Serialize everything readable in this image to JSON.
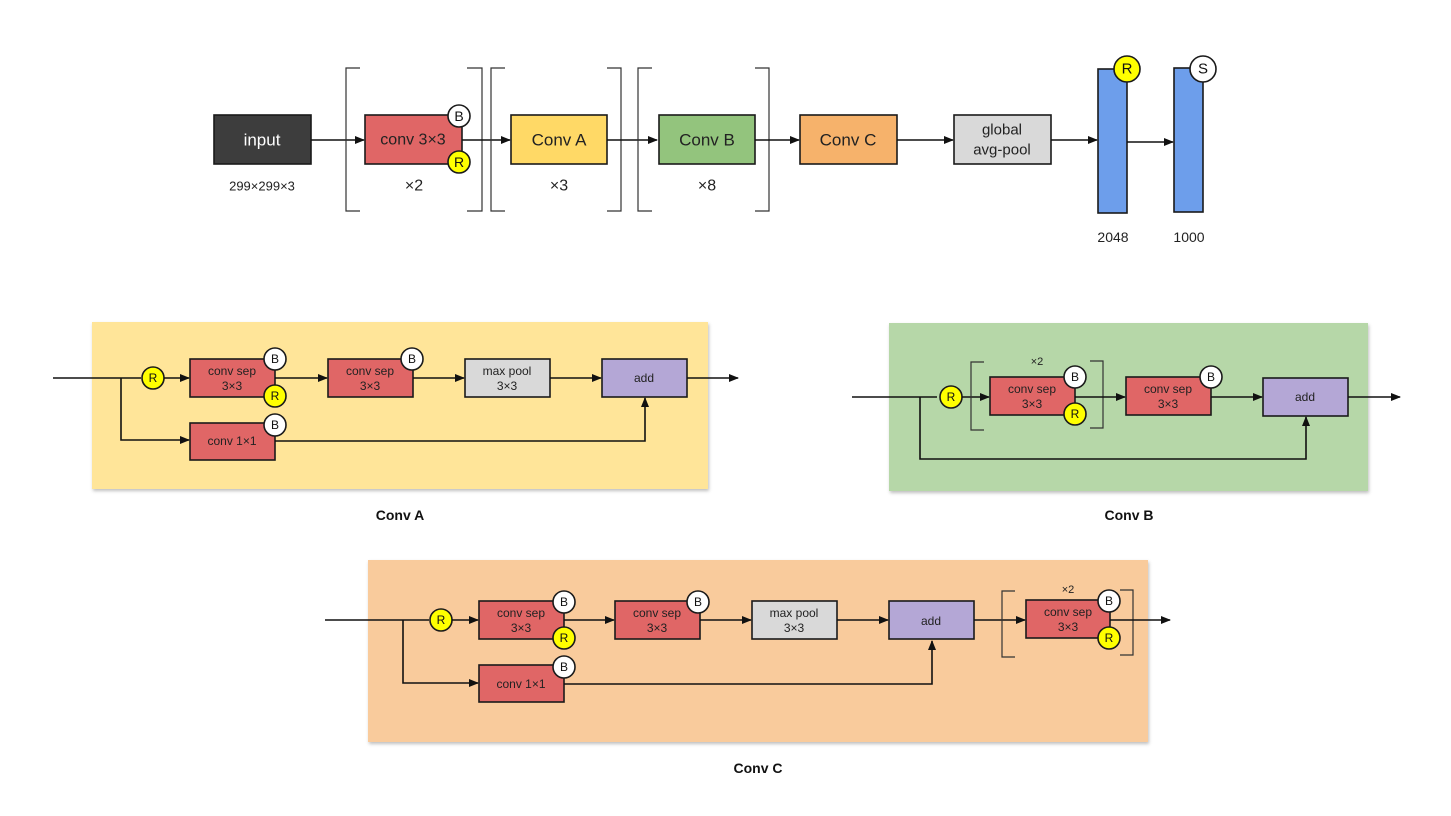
{
  "colors": {
    "input": "#3d3d3d",
    "conv": "#e06666",
    "conv_a": "#ffd966",
    "conv_b": "#93c47d",
    "conv_c": "#f6b26b",
    "pool": "#d9d9d9",
    "add": "#b4a7d6",
    "dense": "#6d9eeb",
    "badge_r": "#ffff00",
    "badge_b": "#ffffff",
    "panel_a": "#ffe599",
    "panel_b": "#b6d7a8",
    "panel_c": "#f9cb9c"
  },
  "badges": {
    "relu": "R",
    "batchnorm": "B",
    "softmax": "S"
  },
  "main": {
    "input": {
      "label": "input",
      "shape": "299×299×3"
    },
    "stem": {
      "label": "conv 3×3",
      "repeat": "×2"
    },
    "conv_a": {
      "label": "Conv A",
      "repeat": "×3"
    },
    "conv_b": {
      "label": "Conv B",
      "repeat": "×8"
    },
    "conv_c": {
      "label": "Conv C"
    },
    "pool": {
      "line1": "global",
      "line2": "avg-pool"
    },
    "dense1": {
      "units": "2048"
    },
    "dense2": {
      "units": "1000"
    }
  },
  "conv_a_block": {
    "caption": "Conv A",
    "sep1": {
      "line1": "conv sep",
      "line2": "3×3"
    },
    "sep2": {
      "line1": "conv sep",
      "line2": "3×3"
    },
    "pool": {
      "line1": "max pool",
      "line2": "3×3"
    },
    "shortcut": {
      "label": "conv 1×1"
    },
    "add": {
      "label": "add"
    }
  },
  "conv_b_block": {
    "caption": "Conv B",
    "repeat": "×2",
    "sep1": {
      "line1": "conv sep",
      "line2": "3×3"
    },
    "sep2": {
      "line1": "conv sep",
      "line2": "3×3"
    },
    "add": {
      "label": "add"
    }
  },
  "conv_c_block": {
    "caption": "Conv C",
    "sep1": {
      "line1": "conv sep",
      "line2": "3×3"
    },
    "sep2": {
      "line1": "conv sep",
      "line2": "3×3"
    },
    "pool": {
      "line1": "max pool",
      "line2": "3×3"
    },
    "shortcut": {
      "label": "conv 1×1"
    },
    "add": {
      "label": "add"
    },
    "repeat": "×2",
    "sep3": {
      "line1": "conv sep",
      "line2": "3×3"
    }
  }
}
